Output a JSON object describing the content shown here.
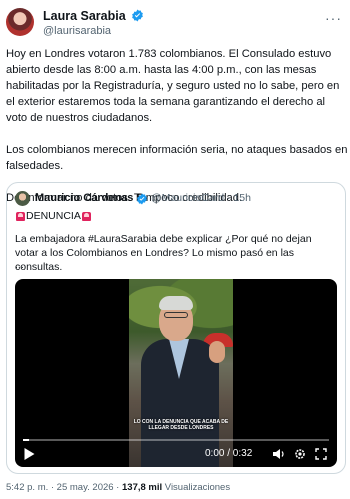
{
  "author": {
    "name": "Laura Sarabia",
    "handle": "@laurisarabia"
  },
  "tweet": {
    "paragraphs": [
      "Hoy en Londres votaron 1.783 colombianos. El Consulado estuvo abierto desde las 8:00 a.m. hasta las 4:00 p.m., con las mesas habilitadas por la Registraduría, y seguro usted no lo sabe, pero en el exterior estaremos toda la semana garantizando el derecho al voto de nuestros ciudadanos.",
      "Los colombianos merecen información seria, no ataques basados en falsedades.",
      "Desinformar no da votos. Tampoco credibilidad."
    ]
  },
  "quoted": {
    "name": "Mauricio Cárdenas S.",
    "handle": "@MauricioCard",
    "time": "· 15h",
    "badge": "DENUNCIA",
    "text": "La embajadora #LauraSarabia debe explicar ¿Por qué no dejan votar a los Colombianos en Londres? Lo mismo pasó en las consultas.",
    "ellipsis": "...",
    "video": {
      "caption": "LO CON LA DENUNCIA QUE ACABA DE LLEGAR DESDE LONDRES",
      "time_display": "0:00 / 0:32",
      "progress": 0.02
    }
  },
  "meta": {
    "time_date": "5:42 p. m. · 25 may. 2026 ·",
    "views_count": "137,8 mil",
    "views_label": "Visualizaciones"
  },
  "icons": {
    "verified": "verified-badge-icon",
    "more": "more-icon",
    "play": "play-icon",
    "volume": "volume-icon",
    "settings": "gear-icon",
    "fullscreen": "fullscreen-icon"
  },
  "colors": {
    "verified": "#1d9bf0",
    "text": "#0f1419",
    "secondary": "#536471",
    "border": "#cfd9de"
  }
}
